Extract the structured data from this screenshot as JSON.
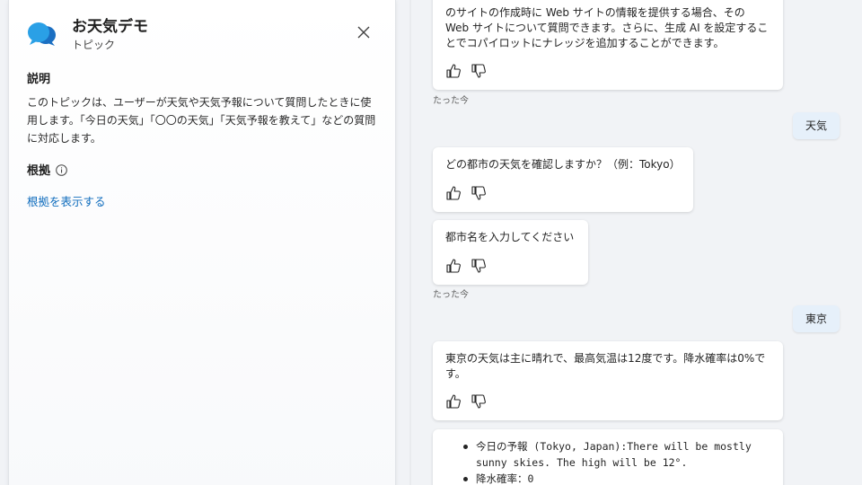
{
  "panel": {
    "title": "お天気デモ",
    "subtitle": "トピック",
    "description_heading": "説明",
    "description": "このトピックは、ユーザーが天気や天気予報について質問したときに使用します。「今日の天気」「〇〇の天気」「天気予報を教えて」などの質問に対応します。",
    "basis_heading": "根拠",
    "show_basis_link": "根拠を表示する"
  },
  "chat": {
    "message1_text": "のサイトの作成時に Web サイトの情報を提供する場合、その Web サイトについて質問できます。さらに、生成 AI を設定することでコパイロットにナレッジを追加することができます。",
    "timestamp1": "たった今",
    "user1": "天気",
    "bot2": "どの都市の天気を確認しますか？（例：Tokyo）",
    "bot3": "都市名を入力してください",
    "timestamp2": "たった今",
    "user2": "東京",
    "bot4": "東京の天気は主に晴れで、最高気温は12度です。降水確率は0%です。",
    "bot5_items": [
      "今日の予報 (Tokyo, Japan):There will be mostly sunny skies. The high will be 12°.",
      "降水確率：0"
    ]
  },
  "colors": {
    "accent": "#0f6cbd",
    "user_bubble": "#e6f0fa",
    "background": "#f1f3f6"
  }
}
